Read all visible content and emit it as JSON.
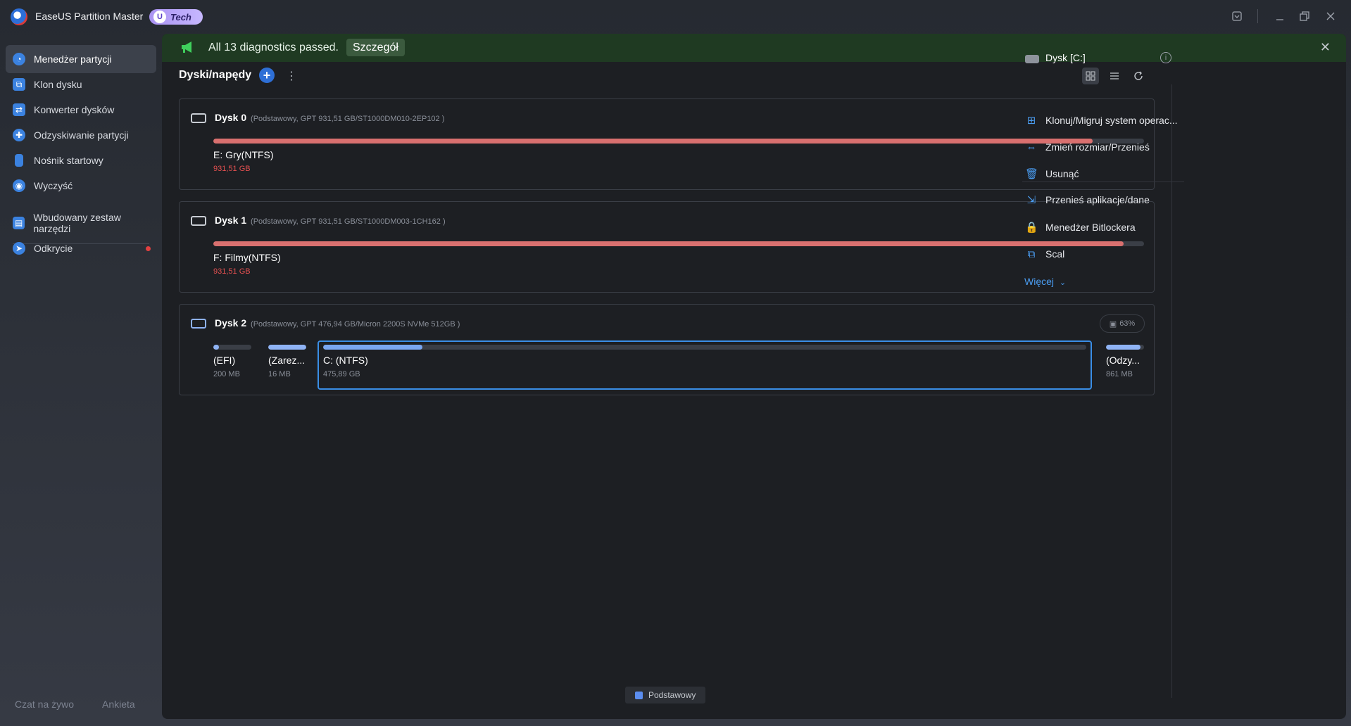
{
  "app": {
    "name": "EaseUS Partition Master",
    "badge": "Tech",
    "badge_letter": "U"
  },
  "sidebar": {
    "items": [
      {
        "label": "Menedżer partycji",
        "icon": "pie-chart-icon",
        "active": true
      },
      {
        "label": "Klon dysku",
        "icon": "clone-icon"
      },
      {
        "label": "Konwerter dysków",
        "icon": "convert-icon"
      },
      {
        "label": "Odzyskiwanie partycji",
        "icon": "recovery-icon"
      },
      {
        "label": "Nośnik startowy",
        "icon": "usb-icon"
      },
      {
        "label": "Wyczyść",
        "icon": "clean-icon"
      },
      {
        "label": "Wbudowany zestaw narzędzi",
        "icon": "toolkit-icon"
      },
      {
        "label": "Odkrycie",
        "icon": "compass-icon",
        "notification_dot": true
      }
    ],
    "footer": {
      "chat": "Czat na żywo",
      "survey": "Ankieta"
    }
  },
  "banner": {
    "text": "All 13 diagnostics passed.",
    "button": "Szczegół",
    "icon": "megaphone-icon"
  },
  "main": {
    "title": "Dyski/napędy",
    "disks": [
      {
        "name": "Dysk 0",
        "info": "(Podstawowy, GPT 931,51 GB/ST1000DM010-2EP102 )",
        "partitions": [
          {
            "name": "E: Gry(NTFS)",
            "size": "931,51 GB",
            "usage": 0.945,
            "color": "#d9706f"
          }
        ]
      },
      {
        "name": "Dysk 1",
        "info": "(Podstawowy, GPT 931,51 GB/ST1000DM003-1CH162 )",
        "partitions": [
          {
            "name": "F: Filmy(NTFS)",
            "size": "931,51 GB",
            "usage": 0.978,
            "color": "#d9706f"
          }
        ]
      },
      {
        "name": "Dysk 2",
        "info": "(Podstawowy, GPT 476,94 GB/Micron 2200S NVMe 512GB )",
        "usage_badge": "63%",
        "partitions": [
          {
            "name": "(EFI)",
            "size": "200 MB",
            "usage": 0.15,
            "color": "#8fb3f5"
          },
          {
            "name": "(Zarez...",
            "size": "16 MB",
            "usage": 1.0,
            "color": "#8fb3f5"
          },
          {
            "name": "C: (NTFS)",
            "size": "475,89 GB",
            "usage": 0.13,
            "color": "#7aa7f2",
            "selected": true
          },
          {
            "name": "(Odzy...",
            "size": "861 MB",
            "usage": 0.9,
            "color": "#8fb3f5"
          }
        ]
      }
    ],
    "legend": "Podstawowy"
  },
  "right_panel": {
    "title": "Dysk [C:]",
    "actions": [
      {
        "label": "Klonuj/Migruj system operac...",
        "icon": "windows-icon"
      },
      {
        "label": "Zmień rozmiar/Przenieś",
        "icon": "resize-icon"
      },
      {
        "label": "Usunąć",
        "icon": "trash-icon"
      },
      {
        "label": "Przenieś aplikacje/dane",
        "icon": "move-apps-icon"
      },
      {
        "label": "Menedżer Bitlockera",
        "icon": "bitlocker-icon"
      },
      {
        "label": "Scal",
        "icon": "merge-icon"
      }
    ],
    "more": "Więcej"
  }
}
